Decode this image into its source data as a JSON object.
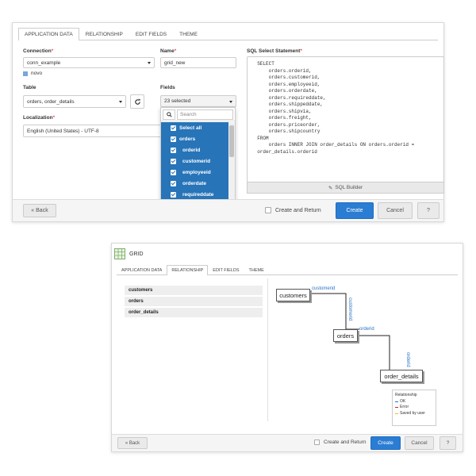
{
  "panel1": {
    "tabs": [
      "APPLICATION DATA",
      "RELATIONSHIP",
      "EDIT FIELDS",
      "THEME"
    ],
    "connection": {
      "label": "Connection",
      "required": "*",
      "value": "conn_example",
      "hint": "novo"
    },
    "name": {
      "label": "Name",
      "required": "*",
      "value": "grid_new"
    },
    "table": {
      "label": "Table",
      "value": "orders, order_details"
    },
    "fields": {
      "label": "Fields",
      "value": "23 selected"
    },
    "localization": {
      "label": "Localization",
      "required": "*",
      "value": "English (United States) - UTF-8"
    },
    "sql": {
      "label": "SQL Select Statement",
      "required": "*",
      "text": "  SELECT\n      orders.orderid,\n      orders.customerid,\n      orders.employeeid,\n      orders.orderdate,\n      orders.requireddate,\n      orders.shippeddate,\n      orders.shipvia,\n      orders.freight,\n      orders.priceorder,\n      orders.shipcountry\n  FROM\n      orders INNER JOIN order_details ON orders.orderid =\n  order_details.orderid",
      "builder": "SQL Builder"
    },
    "dropdown": {
      "search_placeholder": "Search",
      "select_all": "Select all",
      "group": "orders",
      "items": [
        "orderid",
        "customerid",
        "employeeid",
        "orderdate",
        "requireddate"
      ]
    },
    "footer": {
      "back": "« Back",
      "create_return": "Create and Return",
      "create": "Create",
      "cancel": "Cancel",
      "help": "?"
    }
  },
  "panel2": {
    "title": "GRID",
    "tabs": [
      "APPLICATION DATA",
      "RELATIONSHIP",
      "EDIT FIELDS",
      "THEME"
    ],
    "tables": [
      "customers",
      "orders",
      "order_details"
    ],
    "diagram": {
      "nodes": [
        "customers",
        "orders",
        "order_details"
      ],
      "edges": [
        {
          "h": "customerid",
          "v": "customerid"
        },
        {
          "h": "orderid",
          "v": "orderid"
        }
      ]
    },
    "legend": {
      "title": "Relationship",
      "items": [
        {
          "label": "OK",
          "color": "#2a73c4"
        },
        {
          "label": "Error",
          "color": "#d42020"
        },
        {
          "label": "Saved by user",
          "color": "#e8c020"
        }
      ]
    },
    "footer": {
      "back": "« Back",
      "create_return": "Create and Return",
      "create": "Create",
      "cancel": "Cancel",
      "help": "?"
    }
  },
  "colors": {
    "primary": "#2b7dd3",
    "selection": "#2774b8",
    "link": "#2a73c4"
  }
}
